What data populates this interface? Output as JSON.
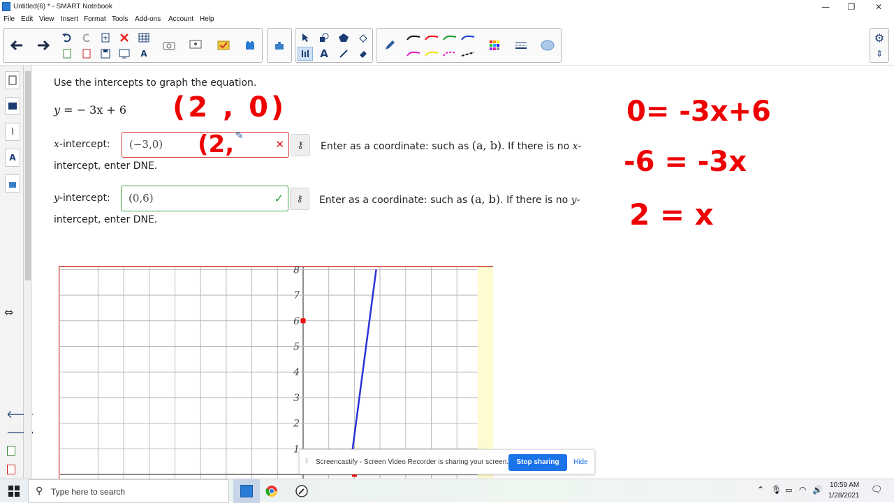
{
  "window": {
    "title": "Untitled(6) * - SMART Notebook",
    "controls": [
      "—",
      "❐",
      "✕"
    ]
  },
  "menu": [
    "File",
    "Edit",
    "View",
    "Insert",
    "Format",
    "Tools",
    "Add-ons",
    "Account",
    "Help"
  ],
  "sidebar_icons": [
    "page-sorter-icon",
    "gallery-icon",
    "attachments-icon",
    "properties-icon",
    "add-ons-icon"
  ],
  "problem": {
    "instruction": "Use the intercepts to graph the equation.",
    "equation_lhs": "y",
    "equation_rhs": "= − 3x + 6",
    "x_label": "x",
    "x_label_suffix": "-intercept:",
    "x_value": "(−3,0)",
    "x_status": "✕",
    "x_hint_a": "Enter as a coordinate: such as ",
    "x_hint_math": "(a, b)",
    "x_hint_b": ". If there is no ",
    "x_hint_var": "x",
    "x_hint_c": "-",
    "x_hint_line2": "intercept, enter DNE.",
    "y_label": "y",
    "y_label_suffix": "-intercept:",
    "y_value": "(0,6)",
    "y_status": "✓",
    "y_hint_a": "Enter as a coordinate: such as ",
    "y_hint_math": "(a, b)",
    "y_hint_b": ". If there is no ",
    "y_hint_var": "y",
    "y_hint_c": "-",
    "y_hint_line2": "intercept, enter DNE."
  },
  "handwriting": {
    "point": "(2 , 0)",
    "partial": "(2,",
    "line1": "0= -3x+6",
    "line2": "-6 = -3x",
    "line3": "2 = x",
    "color": "#e8101a"
  },
  "chart_data": {
    "type": "line",
    "title": "",
    "xlabel": "",
    "ylabel": "",
    "y_ticks": [
      1,
      2,
      3,
      4,
      5,
      6,
      7,
      8
    ],
    "xlim": [
      -8,
      8
    ],
    "ylim": [
      0,
      8
    ],
    "grid": true,
    "series": [
      {
        "x": [
          1.8,
          2.85
        ],
        "y": [
          0,
          8
        ],
        "color": "#2a33d6"
      }
    ],
    "points": [
      {
        "x": 0,
        "y": 6,
        "color": "#e11"
      },
      {
        "x": 2,
        "y": 0,
        "color": "#e11"
      }
    ]
  },
  "notification": {
    "text": "Screencastify - Screen Video Recorder is sharing your screen.",
    "primary": "Stop sharing",
    "secondary": "Hide"
  },
  "taskbar": {
    "search_placeholder": "Type here to search",
    "time": "10:59 AM",
    "date": "1/28/2021"
  }
}
